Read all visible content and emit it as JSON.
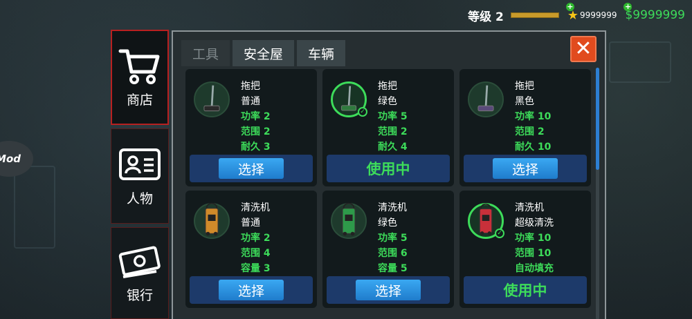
{
  "hud": {
    "level_label": "等级 2",
    "level_progress": 0.9,
    "coins": "9999999",
    "money": "$9999999"
  },
  "mod_button": "Mod",
  "nav": {
    "items": [
      {
        "label": "商店",
        "icon": "cart-icon",
        "active": true
      },
      {
        "label": "人物",
        "icon": "id-card-icon",
        "active": false
      },
      {
        "label": "银行",
        "icon": "money-icon",
        "active": false
      }
    ]
  },
  "tabs": [
    {
      "label": "工具",
      "active": false
    },
    {
      "label": "安全屋",
      "active": true
    },
    {
      "label": "车辆",
      "active": false
    }
  ],
  "close_label": "✕",
  "cards": [
    {
      "name": "拖把",
      "variant": "普通",
      "stats": [
        "功率 2",
        "范围 2",
        "耐久 3"
      ],
      "action": "选择",
      "in_use": false,
      "type": "mop",
      "color": "#2a2a2a"
    },
    {
      "name": "拖把",
      "variant": "绿色",
      "stats": [
        "功率 5",
        "范围 2",
        "耐久 4"
      ],
      "action": "使用中",
      "in_use": true,
      "type": "mop",
      "color": "#2f7a3e"
    },
    {
      "name": "拖把",
      "variant": "黑色",
      "stats": [
        "功率 10",
        "范围 2",
        "耐久 10"
      ],
      "action": "选择",
      "in_use": false,
      "type": "mop",
      "color": "#5a4a7a"
    },
    {
      "name": "清洗机",
      "variant": "普通",
      "stats": [
        "功率 2",
        "范围 4",
        "容量 3"
      ],
      "action": "选择",
      "in_use": false,
      "type": "washer",
      "color": "#d08a2a"
    },
    {
      "name": "清洗机",
      "variant": "绿色",
      "stats": [
        "功率 5",
        "范围 6",
        "容量 5"
      ],
      "action": "选择",
      "in_use": false,
      "type": "washer",
      "color": "#2e9a4a"
    },
    {
      "name": "清洗机",
      "variant": "超级清洗",
      "stats": [
        "功率 10",
        "范围 10",
        "自动填充"
      ],
      "action": "使用中",
      "in_use": true,
      "type": "washer",
      "color": "#c8303a"
    }
  ]
}
